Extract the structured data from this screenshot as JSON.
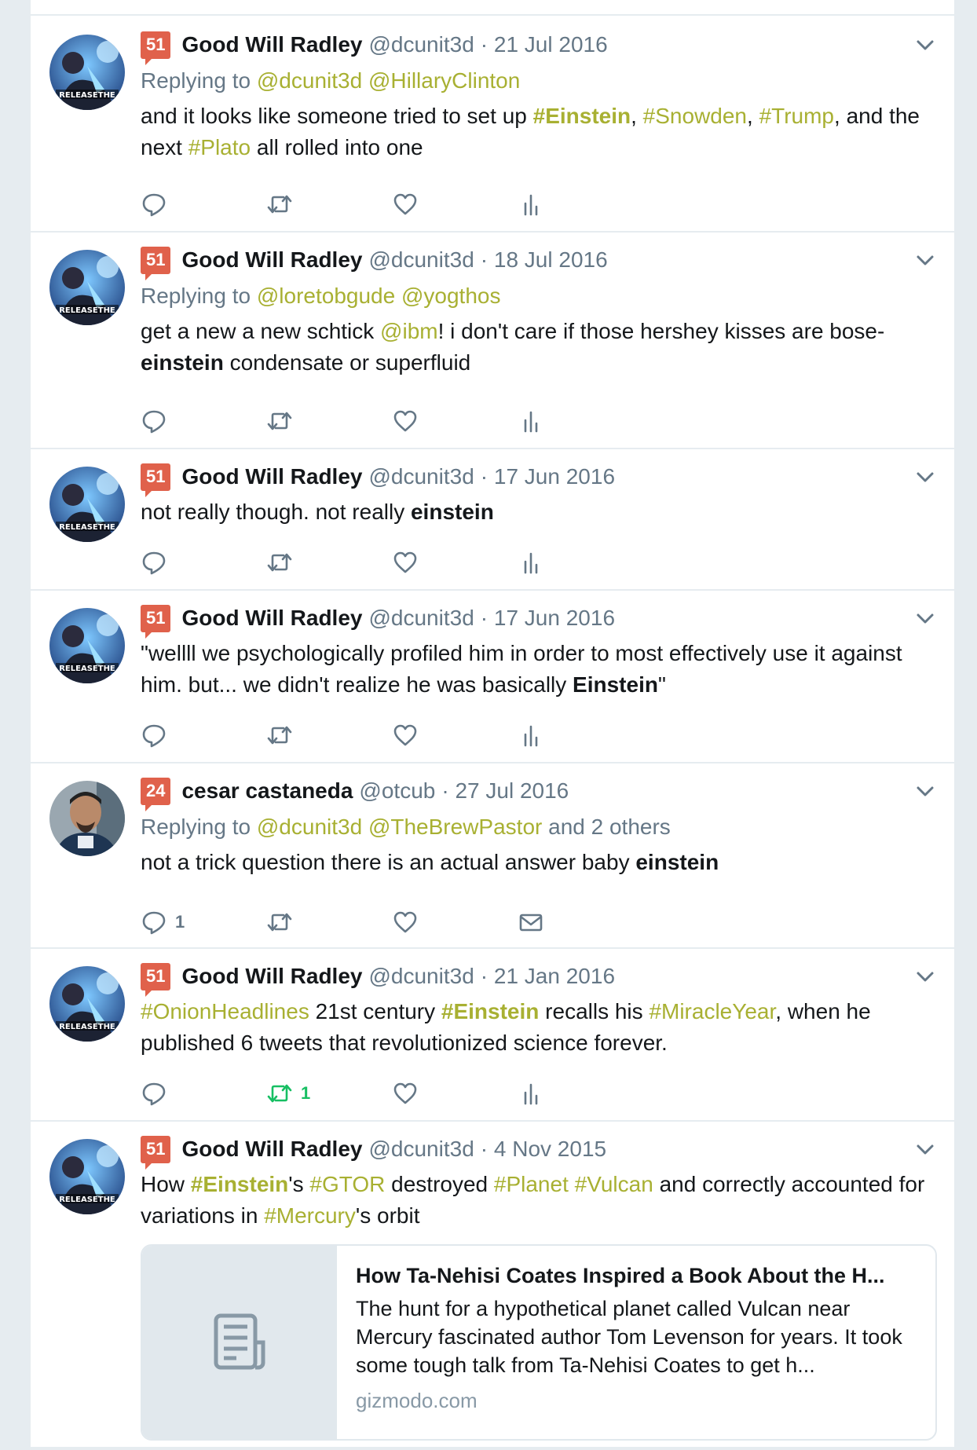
{
  "colors": {
    "accent": "#a8b032",
    "badge": "#e0614b",
    "muted": "#657786",
    "retweeted": "#17bf63"
  },
  "tweets": [
    {
      "badge": "51",
      "name": "Good Will Radley",
      "handle": "@dcunit3d",
      "date": "· 21 Jul 2016",
      "reply_prefix": "Replying to",
      "reply_to": [
        "@dcunit3d",
        "@HillaryClinton"
      ],
      "reply_suffix": "",
      "text": [
        {
          "t": "and it looks like someone tried to set up "
        },
        {
          "t": "#Einstein",
          "link": true,
          "bold": true
        },
        {
          "t": ", "
        },
        {
          "t": "#Snowden",
          "link": true
        },
        {
          "t": ", "
        },
        {
          "t": "#Trump",
          "link": true
        },
        {
          "t": ", and the next "
        },
        {
          "t": "#Plato",
          "link": true
        },
        {
          "t": " all rolled into one"
        }
      ],
      "actions": {
        "reply_count": "",
        "retweet_count": "",
        "retweeted": false,
        "fourth": "analytics-icon"
      }
    },
    {
      "badge": "51",
      "name": "Good Will Radley",
      "handle": "@dcunit3d",
      "date": "· 18 Jul 2016",
      "reply_prefix": "Replying to",
      "reply_to": [
        "@loretobgude",
        "@yogthos"
      ],
      "reply_suffix": "",
      "text": [
        {
          "t": "get a new a new schtick "
        },
        {
          "t": "@ibm",
          "link": true
        },
        {
          "t": "! i don't care if those hershey kisses are bose-"
        },
        {
          "t": "einstein",
          "bold": true
        },
        {
          "t": " condensate or superfluid"
        }
      ],
      "actions": {
        "reply_count": "",
        "retweet_count": "",
        "retweeted": false,
        "fourth": "analytics-icon"
      }
    },
    {
      "badge": "51",
      "name": "Good Will Radley",
      "handle": "@dcunit3d",
      "date": "· 17 Jun 2016",
      "reply_prefix": "",
      "reply_to": [],
      "reply_suffix": "",
      "text": [
        {
          "t": "not really though.  not really "
        },
        {
          "t": "einstein",
          "bold": true
        }
      ],
      "actions": {
        "reply_count": "",
        "retweet_count": "",
        "retweeted": false,
        "fourth": "analytics-icon"
      }
    },
    {
      "badge": "51",
      "name": "Good Will Radley",
      "handle": "@dcunit3d",
      "date": "· 17 Jun 2016",
      "reply_prefix": "",
      "reply_to": [],
      "reply_suffix": "",
      "text": [
        {
          "t": "\"wellll we psychologically profiled him in order to most effectively use it against him. but... we didn't realize he was basically "
        },
        {
          "t": "Einstein",
          "bold": true
        },
        {
          "t": "\""
        }
      ],
      "actions": {
        "reply_count": "",
        "retweet_count": "",
        "retweeted": false,
        "fourth": "analytics-icon"
      }
    },
    {
      "badge": "24",
      "name": "cesar castaneda",
      "handle": "@otcub",
      "date": "· 27 Jul 2016",
      "reply_prefix": "Replying to",
      "reply_to": [
        "@dcunit3d",
        "@TheBrewPastor"
      ],
      "reply_suffix": "and 2 others",
      "text": [
        {
          "t": "not a trick question there is an actual answer baby "
        },
        {
          "t": "einstein",
          "bold": true
        }
      ],
      "actions": {
        "reply_count": "1",
        "retweet_count": "",
        "retweeted": false,
        "fourth": "mail-icon"
      }
    },
    {
      "badge": "51",
      "name": "Good Will Radley",
      "handle": "@dcunit3d",
      "date": "· 21 Jan 2016",
      "reply_prefix": "",
      "reply_to": [],
      "reply_suffix": "",
      "text": [
        {
          "t": "#OnionHeadlines",
          "link": true
        },
        {
          "t": " 21st century "
        },
        {
          "t": "#Einstein",
          "link": true,
          "bold": true
        },
        {
          "t": " recalls his "
        },
        {
          "t": "#MiracleYear",
          "link": true
        },
        {
          "t": ", when he published 6 tweets that revolutionized science forever."
        }
      ],
      "actions": {
        "reply_count": "",
        "retweet_count": "1",
        "retweeted": true,
        "fourth": "analytics-icon"
      }
    },
    {
      "badge": "51",
      "name": "Good Will Radley",
      "handle": "@dcunit3d",
      "date": "· 4 Nov 2015",
      "reply_prefix": "",
      "reply_to": [],
      "reply_suffix": "",
      "text": [
        {
          "t": "How "
        },
        {
          "t": "#Einstein",
          "link": true,
          "bold": true
        },
        {
          "t": "'s "
        },
        {
          "t": "#GTOR",
          "link": true
        },
        {
          "t": " destroyed "
        },
        {
          "t": "#Planet",
          "link": true
        },
        {
          "t": " "
        },
        {
          "t": "#Vulcan",
          "link": true
        },
        {
          "t": " and correctly accounted for variations in "
        },
        {
          "t": "#Mercury",
          "link": true
        },
        {
          "t": "'s orbit"
        }
      ],
      "card": {
        "title": "How Ta-Nehisi Coates Inspired a Book About the H...",
        "description": "The hunt for a hypothetical planet called Vulcan near Mercury fascinated author Tom Levenson for years. It took some tough talk from Ta-Nehisi Coates to get h...",
        "domain": "gizmodo.com",
        "icon": "document-icon"
      }
    }
  ]
}
